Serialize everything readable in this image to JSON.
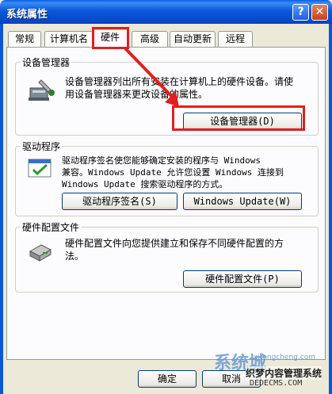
{
  "window": {
    "title": "系统属性",
    "help_label": "?",
    "close_label": "✕"
  },
  "tabs": [
    {
      "label": "常规",
      "active": false
    },
    {
      "label": "计算机名",
      "active": false
    },
    {
      "label": "硬件",
      "active": true
    },
    {
      "label": "高级",
      "active": false
    },
    {
      "label": "自动更新",
      "active": false
    },
    {
      "label": "远程",
      "active": false
    }
  ],
  "device_manager": {
    "group_label": "设备管理器",
    "description_line1": "设备管理器列出所有安装在计算机上的硬件设备。请使",
    "description_line2": "用设备管理器来更改设备的属性。",
    "button_label": "设备管理器(D)"
  },
  "driver": {
    "group_label": "驱动程序",
    "description_line1": "驱动程序签名使您能够确定安装的程序与 Windows",
    "description_line2": "兼容。Windows Update 允许您设置 Windows 连接到",
    "description_line3": "Windows Update 搜索驱动程序的方式。",
    "signing_button": "驱动程序签名(S)",
    "update_button": "Windows Update(W)"
  },
  "hardware_profiles": {
    "group_label": "硬件配置文件",
    "description_line1": "硬件配置文件向您提供建立和保存不同硬件配置的方",
    "description_line2": "法。",
    "button_label": "硬件配置文件(P)"
  },
  "footer": {
    "ok_label": "确定",
    "cancel_label": "取消"
  },
  "watermark": {
    "line1": "系统城",
    "line2": "织梦内容管理系统",
    "line3": "DEDECMS.COM",
    "line4": "xitongcheng.com"
  },
  "colors": {
    "titlebar": "#0b56d6",
    "highlight": "#e02020",
    "tab_accent": "#ffc83c"
  }
}
